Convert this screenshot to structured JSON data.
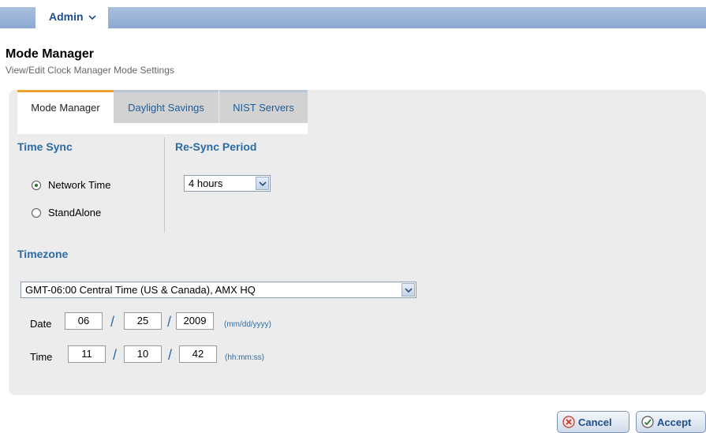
{
  "nav": {
    "admin_label": "Admin"
  },
  "page": {
    "title": "Mode Manager",
    "subtitle": "View/Edit Clock Manager Mode Settings"
  },
  "tabs": [
    {
      "label": "Mode Manager",
      "active": true
    },
    {
      "label": "Daylight Savings",
      "active": false
    },
    {
      "label": "NIST Servers",
      "active": false
    }
  ],
  "time_sync": {
    "title": "Time Sync",
    "options": [
      {
        "label": "Network Time",
        "checked": true
      },
      {
        "label": "StandAlone",
        "checked": false
      }
    ]
  },
  "resync": {
    "title": "Re-Sync Period",
    "value": "4 hours"
  },
  "timezone": {
    "title": "Timezone",
    "value": "GMT-06:00 Central Time (US & Canada), AMX HQ"
  },
  "date": {
    "label": "Date",
    "month": "06",
    "day": "25",
    "year": "2009",
    "hint": "(mm/dd/yyyy)",
    "separator": "/"
  },
  "time": {
    "label": "Time",
    "hh": "11",
    "mm": "10",
    "ss": "42",
    "hint": "(hh:mm:ss)",
    "separator": "/"
  },
  "buttons": {
    "cancel": "Cancel",
    "accept": "Accept"
  },
  "icons": {
    "admin_chevron": "chevron-down-icon",
    "select_arrow": "chevron-down-icon",
    "cancel": "x-circle-icon",
    "accept": "check-circle-icon"
  },
  "colors": {
    "accent_blue": "#2c6ba6",
    "active_tab_indicator": "#f0a030",
    "nav_bar": "#9ab3d8"
  }
}
